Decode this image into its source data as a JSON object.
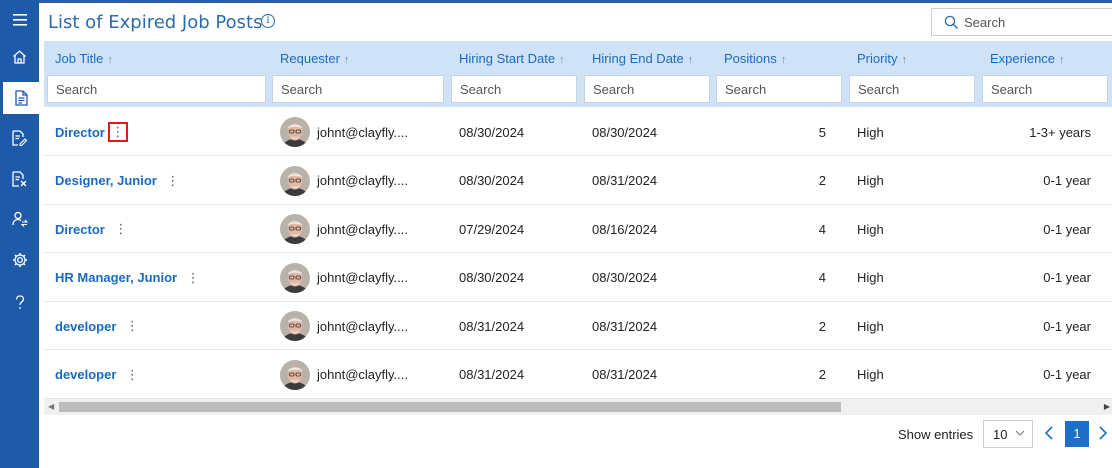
{
  "page": {
    "title": "List of Expired Job Posts",
    "search_placeholder": "Search"
  },
  "sidebar": {
    "items": [
      {
        "icon": "menu-icon"
      },
      {
        "icon": "home-icon"
      },
      {
        "icon": "document-icon",
        "active": true
      },
      {
        "icon": "document-edit-icon"
      },
      {
        "icon": "document-remove-icon"
      },
      {
        "icon": "user-switch-icon"
      },
      {
        "icon": "gear-icon"
      },
      {
        "icon": "help-icon"
      }
    ]
  },
  "table": {
    "filter_placeholder": "Search",
    "columns": [
      {
        "label": "Job Title"
      },
      {
        "label": "Requester"
      },
      {
        "label": "Hiring Start Date"
      },
      {
        "label": "Hiring End Date"
      },
      {
        "label": "Positions"
      },
      {
        "label": "Priority"
      },
      {
        "label": "Experience"
      }
    ],
    "rows": [
      {
        "job_title": "Director",
        "requester": "johnt@clayfly....",
        "start": "08/30/2024",
        "end": "08/30/2024",
        "positions": "5",
        "priority": "High",
        "experience": "1-3+ years"
      },
      {
        "job_title": "Designer, Junior",
        "requester": "johnt@clayfly....",
        "start": "08/30/2024",
        "end": "08/31/2024",
        "positions": "2",
        "priority": "High",
        "experience": "0-1 year"
      },
      {
        "job_title": "Director",
        "requester": "johnt@clayfly....",
        "start": "07/29/2024",
        "end": "08/16/2024",
        "positions": "4",
        "priority": "High",
        "experience": "0-1 year"
      },
      {
        "job_title": "HR Manager, Junior",
        "requester": "johnt@clayfly....",
        "start": "08/30/2024",
        "end": "08/30/2024",
        "positions": "4",
        "priority": "High",
        "experience": "0-1 year"
      },
      {
        "job_title": "developer",
        "requester": "johnt@clayfly....",
        "start": "08/31/2024",
        "end": "08/31/2024",
        "positions": "2",
        "priority": "High",
        "experience": "0-1 year"
      },
      {
        "job_title": "developer",
        "requester": "johnt@clayfly....",
        "start": "08/31/2024",
        "end": "08/31/2024",
        "positions": "2",
        "priority": "High",
        "experience": "0-1 year"
      }
    ]
  },
  "footer": {
    "show_entries_label": "Show entries",
    "page_size": "10",
    "current_page": "1"
  },
  "colors": {
    "sidebar": "#1e5aa8",
    "header_bg": "#cfe2f6",
    "link": "#1a6bbf",
    "highlight": "#e21b1b"
  }
}
